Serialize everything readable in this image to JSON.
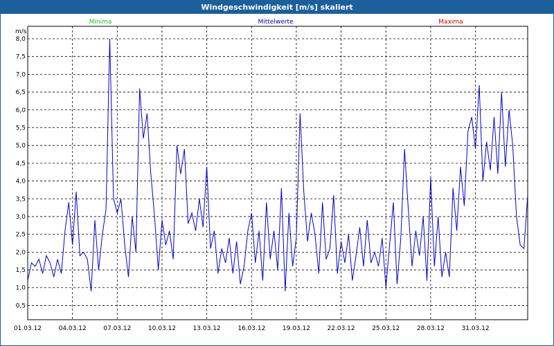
{
  "window": {
    "title": "Windgeschwindigkeit [m/s] skaliert"
  },
  "chart_data": {
    "type": "line",
    "unit_label": "m/s",
    "legend": [
      {
        "name": "Minima",
        "color": "#22bb22"
      },
      {
        "name": "Mittelwerte",
        "color": "#0000cc"
      },
      {
        "name": "Maxima",
        "color": "#cc0000"
      }
    ],
    "x_ticks": [
      "01.03.12",
      "04.03.12",
      "07.03.12",
      "10.03.12",
      "13.03.12",
      "16.03.12",
      "19.03.12",
      "22.03.12",
      "25.03.12",
      "28.03.12",
      "31.03.12"
    ],
    "y_ticks": [
      "0,5",
      "1,0",
      "1,5",
      "2,0",
      "2,5",
      "3,0",
      "3,5",
      "4,0",
      "4,5",
      "5,0",
      "5,5",
      "6,0",
      "6,5",
      "7,0",
      "7,5",
      "8,0"
    ],
    "xlim": [
      1,
      34.5
    ],
    "ylim": [
      0.1,
      8.35
    ],
    "grid": true,
    "series": [
      {
        "name": "Mittelwerte",
        "color": "#0000cc",
        "x": [
          1.0,
          1.25,
          1.5,
          1.75,
          2.0,
          2.25,
          2.5,
          2.75,
          3.0,
          3.25,
          3.5,
          3.75,
          4.0,
          4.25,
          4.5,
          4.75,
          5.0,
          5.25,
          5.5,
          5.75,
          6.0,
          6.25,
          6.5,
          6.75,
          7.0,
          7.25,
          7.5,
          7.75,
          8.0,
          8.25,
          8.5,
          8.75,
          9.0,
          9.25,
          9.5,
          9.75,
          10.0,
          10.25,
          10.5,
          10.75,
          11.0,
          11.25,
          11.5,
          11.75,
          12.0,
          12.25,
          12.5,
          12.75,
          13.0,
          13.25,
          13.5,
          13.75,
          14.0,
          14.25,
          14.5,
          14.75,
          15.0,
          15.25,
          15.5,
          15.75,
          16.0,
          16.25,
          16.5,
          16.75,
          17.0,
          17.25,
          17.5,
          17.75,
          18.0,
          18.25,
          18.5,
          18.75,
          19.0,
          19.25,
          19.5,
          19.75,
          20.0,
          20.25,
          20.5,
          20.75,
          21.0,
          21.25,
          21.5,
          21.75,
          22.0,
          22.25,
          22.5,
          22.75,
          23.0,
          23.25,
          23.5,
          23.75,
          24.0,
          24.25,
          24.5,
          24.75,
          25.0,
          25.25,
          25.5,
          25.75,
          26.0,
          26.25,
          26.5,
          26.75,
          27.0,
          27.25,
          27.5,
          27.75,
          28.0,
          28.25,
          28.5,
          28.75,
          29.0,
          29.25,
          29.5,
          29.75,
          30.0,
          30.25,
          30.5,
          30.75,
          31.0,
          31.25,
          31.5,
          31.75,
          32.0,
          32.25,
          32.5,
          32.75,
          33.0,
          33.25,
          33.5,
          33.75,
          34.0,
          34.25,
          34.5
        ],
        "y": [
          1.2,
          1.7,
          1.6,
          1.8,
          1.4,
          1.9,
          1.7,
          1.3,
          1.8,
          1.4,
          2.6,
          3.4,
          2.2,
          3.7,
          1.9,
          2.0,
          1.8,
          0.9,
          2.9,
          1.5,
          2.5,
          3.2,
          8.0,
          3.5,
          3.1,
          3.5,
          2.2,
          1.3,
          3.0,
          2.0,
          6.6,
          5.2,
          5.9,
          4.2,
          3.0,
          1.5,
          2.9,
          2.2,
          2.6,
          1.8,
          5.0,
          4.2,
          4.9,
          2.8,
          3.1,
          2.6,
          3.5,
          2.7,
          4.4,
          2.1,
          2.6,
          1.4,
          2.1,
          1.7,
          2.4,
          1.4,
          2.3,
          1.1,
          1.6,
          2.6,
          3.1,
          1.7,
          2.6,
          1.2,
          3.4,
          1.8,
          2.6,
          1.5,
          3.8,
          0.9,
          3.1,
          1.6,
          2.4,
          5.9,
          3.7,
          2.3,
          3.1,
          2.5,
          1.4,
          3.4,
          1.8,
          2.1,
          3.6,
          1.4,
          2.3,
          1.7,
          2.5,
          1.2,
          1.9,
          2.7,
          1.6,
          2.9,
          1.7,
          2.0,
          1.6,
          2.4,
          1.0,
          2.2,
          3.4,
          1.1,
          2.4,
          4.9,
          3.2,
          1.6,
          2.6,
          1.9,
          3.0,
          1.2,
          4.1,
          1.6,
          3.0,
          1.3,
          2.0,
          1.3,
          3.8,
          2.6,
          4.4,
          3.3,
          5.4,
          5.8,
          4.9,
          6.7,
          4.0,
          5.1,
          4.3,
          5.8,
          4.2,
          6.5,
          4.4,
          6.0,
          5.0,
          3.0,
          2.2,
          2.1,
          3.6
        ]
      }
    ]
  }
}
